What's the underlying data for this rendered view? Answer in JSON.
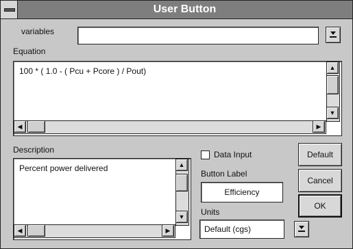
{
  "window": {
    "title": "User Button"
  },
  "variables": {
    "label": "variables",
    "value": ""
  },
  "equation": {
    "label": "Equation",
    "value": "100 * ( 1.0 - ( Pcu + Pcore ) / Pout)"
  },
  "description": {
    "label": "Description",
    "value": "Percent power delivered"
  },
  "data_input": {
    "label": "Data Input",
    "checked": false
  },
  "button_label": {
    "label": "Button Label",
    "value": "Efficiency"
  },
  "units": {
    "label": "Units",
    "value": "Default (cgs)"
  },
  "buttons": {
    "default": "Default",
    "cancel": "Cancel",
    "ok": "OK"
  },
  "icons": {
    "system_menu": "system-menu-icon",
    "dropdown": "dropdown-arrow-icon",
    "scroll_up": "▲",
    "scroll_down": "▼",
    "scroll_left": "◀",
    "scroll_right": "▶"
  }
}
